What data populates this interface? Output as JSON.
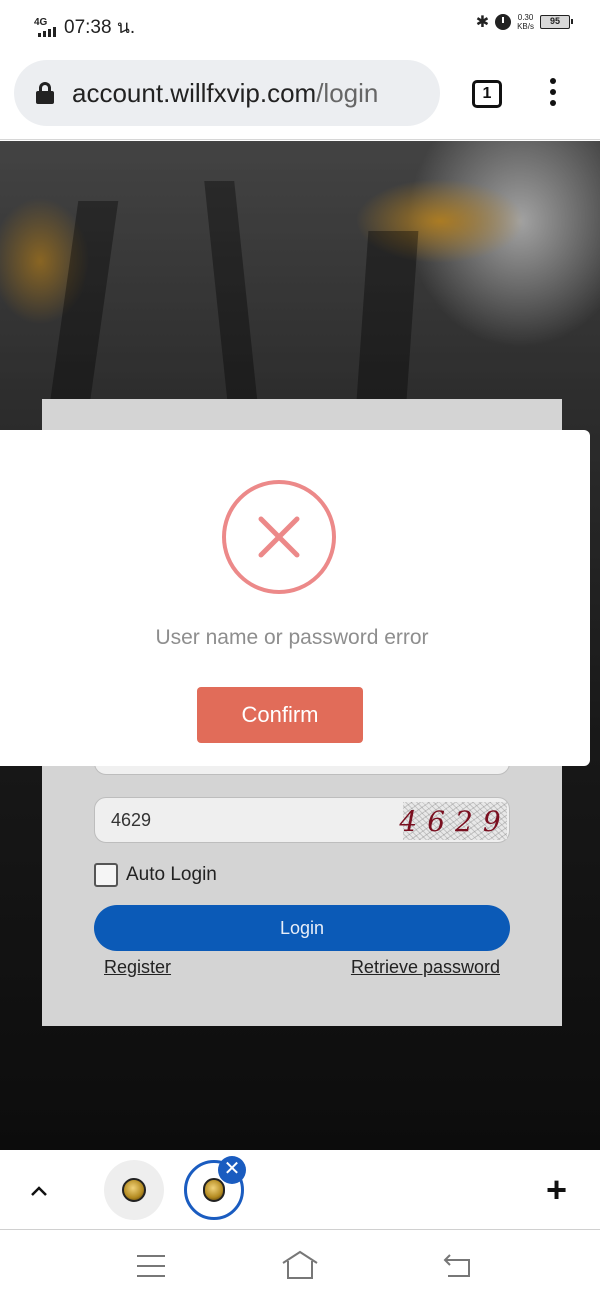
{
  "status_bar": {
    "network": "4G",
    "time": "07:38 น.",
    "speed_value": "0.30",
    "speed_unit": "KB/s",
    "battery": "95"
  },
  "browser": {
    "url_domain": "account.willfxvip.com",
    "url_path": "/login",
    "tab_count": "1"
  },
  "login_form": {
    "captcha_value": "4629",
    "captcha_image_text": "4629",
    "auto_login_label": "Auto Login",
    "login_button": "Login",
    "register_link": "Register",
    "retrieve_password_link": "Retrieve password"
  },
  "modal": {
    "message": "User name or password error",
    "confirm_button": "Confirm",
    "error_color": "#ec8989",
    "confirm_color": "#e16c59"
  },
  "tab_strip": {
    "close_symbol": "✕",
    "new_tab_symbol": "+"
  },
  "colors": {
    "login_button": "#0b5ab7",
    "tab_active_border": "#1a5cc0"
  }
}
